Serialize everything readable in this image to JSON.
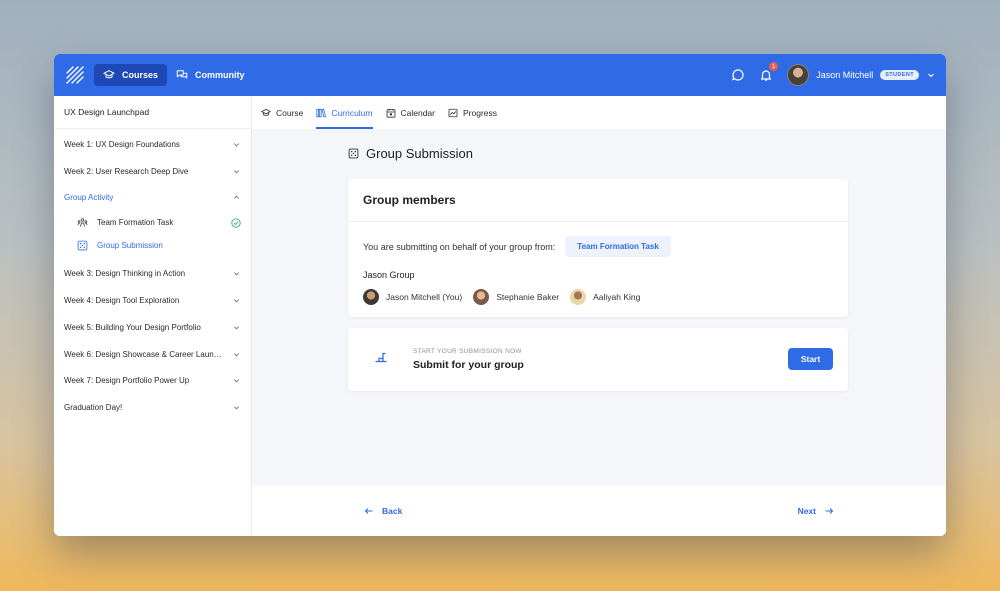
{
  "topbar": {
    "nav": [
      {
        "label": "Courses",
        "icon": "graduation-cap-icon",
        "active": true
      },
      {
        "label": "Community",
        "icon": "chat-bubbles-icon",
        "active": false
      }
    ],
    "notification_count": "1",
    "user_name": "Jason Mitchell",
    "role": "STUDENT"
  },
  "sidebar": {
    "title": "UX Design Launchpad",
    "items": [
      {
        "label": "Week 1: UX Design Foundations",
        "expanded": false
      },
      {
        "label": "Week 2: User Research Deep Dive",
        "expanded": false
      },
      {
        "label": "Group Activity",
        "expanded": true,
        "active": true
      }
    ],
    "sub_items": [
      {
        "label": "Team Formation Task",
        "icon": "team-icon",
        "completed": true
      },
      {
        "label": "Group Submission",
        "icon": "dice-icon",
        "active": true
      }
    ],
    "items_after": [
      {
        "label": "Week 3: Design Thinking in Action"
      },
      {
        "label": "Week 4: Design Tool Exploration"
      },
      {
        "label": "Week 5: Building Your Design Portfolio"
      },
      {
        "label": "Week 6: Design Showcase & Career Launch"
      },
      {
        "label": "Week 7: Design Portfolio Power Up"
      },
      {
        "label": "Graduation Day!"
      }
    ]
  },
  "tabs": [
    {
      "label": "Course",
      "icon": "graduation-cap-icon"
    },
    {
      "label": "Curriculum",
      "icon": "books-icon",
      "active": true
    },
    {
      "label": "Calendar",
      "icon": "calendar-icon"
    },
    {
      "label": "Progress",
      "icon": "chart-icon"
    }
  ],
  "page": {
    "title": "Group Submission",
    "members_card": {
      "heading": "Group members",
      "behalf_text": "You are submitting on behalf of your group from:",
      "chip": "Team Formation Task",
      "group_name": "Jason Group",
      "members": [
        "Jason Mitchell (You)",
        "Stephanie Baker",
        "Aaliyah King"
      ]
    },
    "submit_card": {
      "kicker": "START YOUR SUBMISSION NOW",
      "title": "Submit for your group",
      "button": "Start"
    }
  },
  "footer": {
    "back": "Back",
    "next": "Next"
  },
  "colors": {
    "accent": "#2f6be6",
    "accent_dark": "#1d48b5",
    "badge": "#ef5a4f",
    "success": "#34b36b"
  }
}
